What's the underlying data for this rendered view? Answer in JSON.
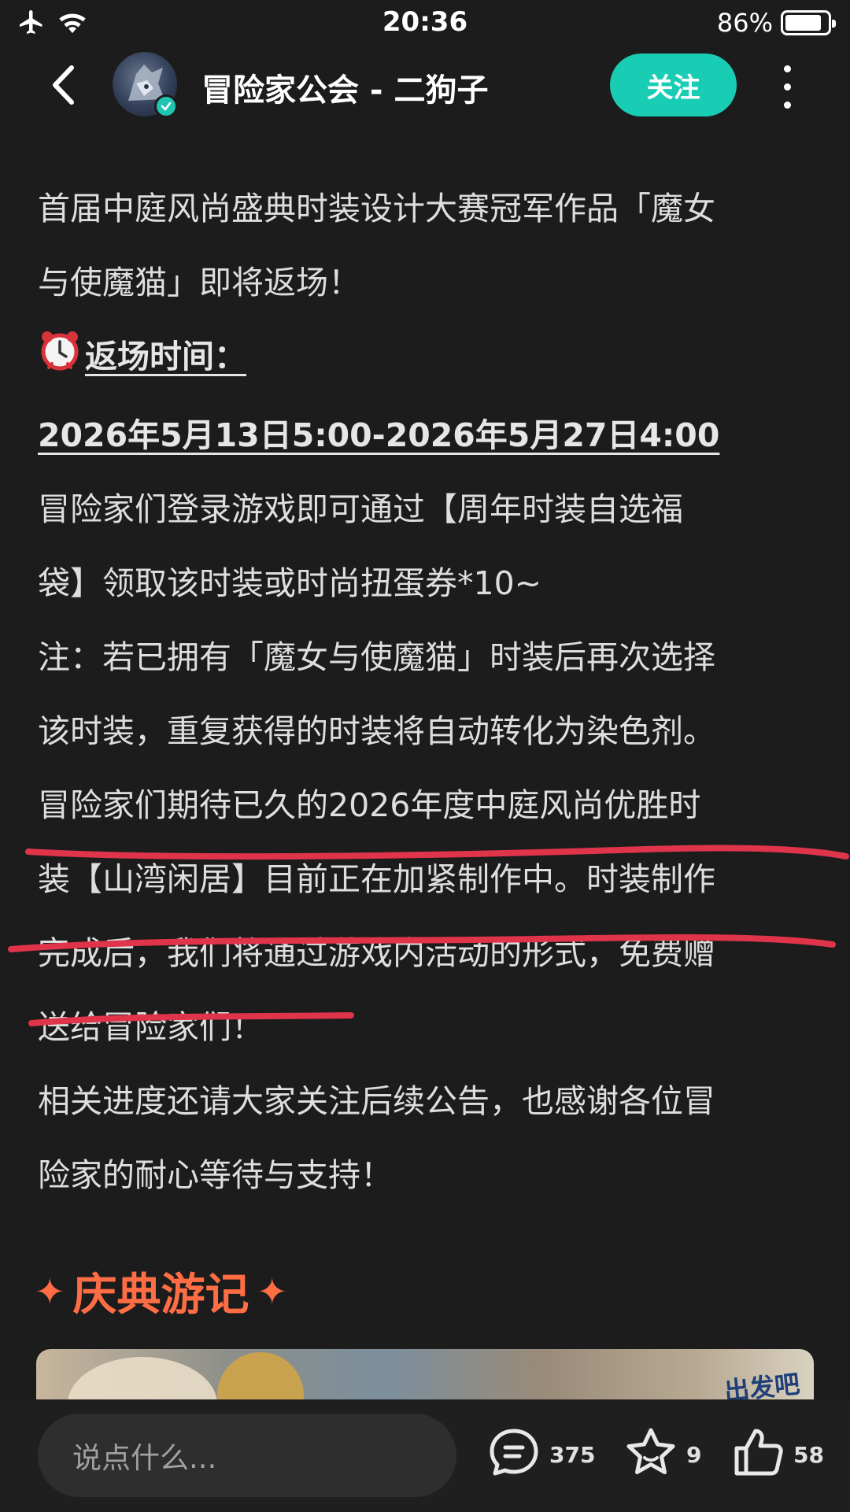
{
  "status_bar": {
    "time": "20:36",
    "battery_percent_label": "86%",
    "battery_level": 0.86,
    "icons": [
      "airplane-icon",
      "wifi-icon",
      "battery-icon"
    ]
  },
  "header": {
    "author_name": "冒险家公会 - 二狗子",
    "follow_label": "关注",
    "icons": [
      "back-chevron-icon",
      "verified-badge-icon",
      "more-dots-icon"
    ]
  },
  "article": {
    "paragraphs": [
      [
        "首届中庭风尚盛典时装设计大赛冠军作品「魔女",
        "与使魔猫」即将返场！"
      ],
      [
        "返场时间："
      ],
      [
        "2026年5月13日5:00-2026年5月27日4:00"
      ],
      [
        "冒险家们登录游戏即可通过【周年时装自选福",
        "袋】领取该时装或时尚扭蛋券*10~"
      ],
      [
        "注：若已拥有「魔女与使魔猫」时装后再次选择",
        "该时装，重复获得的时装将自动转化为染色剂。"
      ],
      [
        "冒险家们期待已久的2026年度中庭风尚优胜时",
        "装【山湾闲居】目前正在加紧制作中。时装制作",
        "完成后，我们将通过游戏内活动的形式，免费赠",
        "送给冒险家们！"
      ],
      [
        "相关进度还请大家关注后续公告，也感谢各位冒",
        "险家的耐心等待与支持！"
      ]
    ],
    "section_title": "庆典游记",
    "banner_text": "出发吧"
  },
  "bottom_bar": {
    "comment_placeholder": "说点什么...",
    "comment_count": "375",
    "favorite_count": "9",
    "like_count": "58"
  },
  "colors": {
    "background": "#1c1c1c",
    "accent_teal": "#19cdb5",
    "section_orange": "#ff6d45",
    "annotation_red": "#e0344a"
  }
}
